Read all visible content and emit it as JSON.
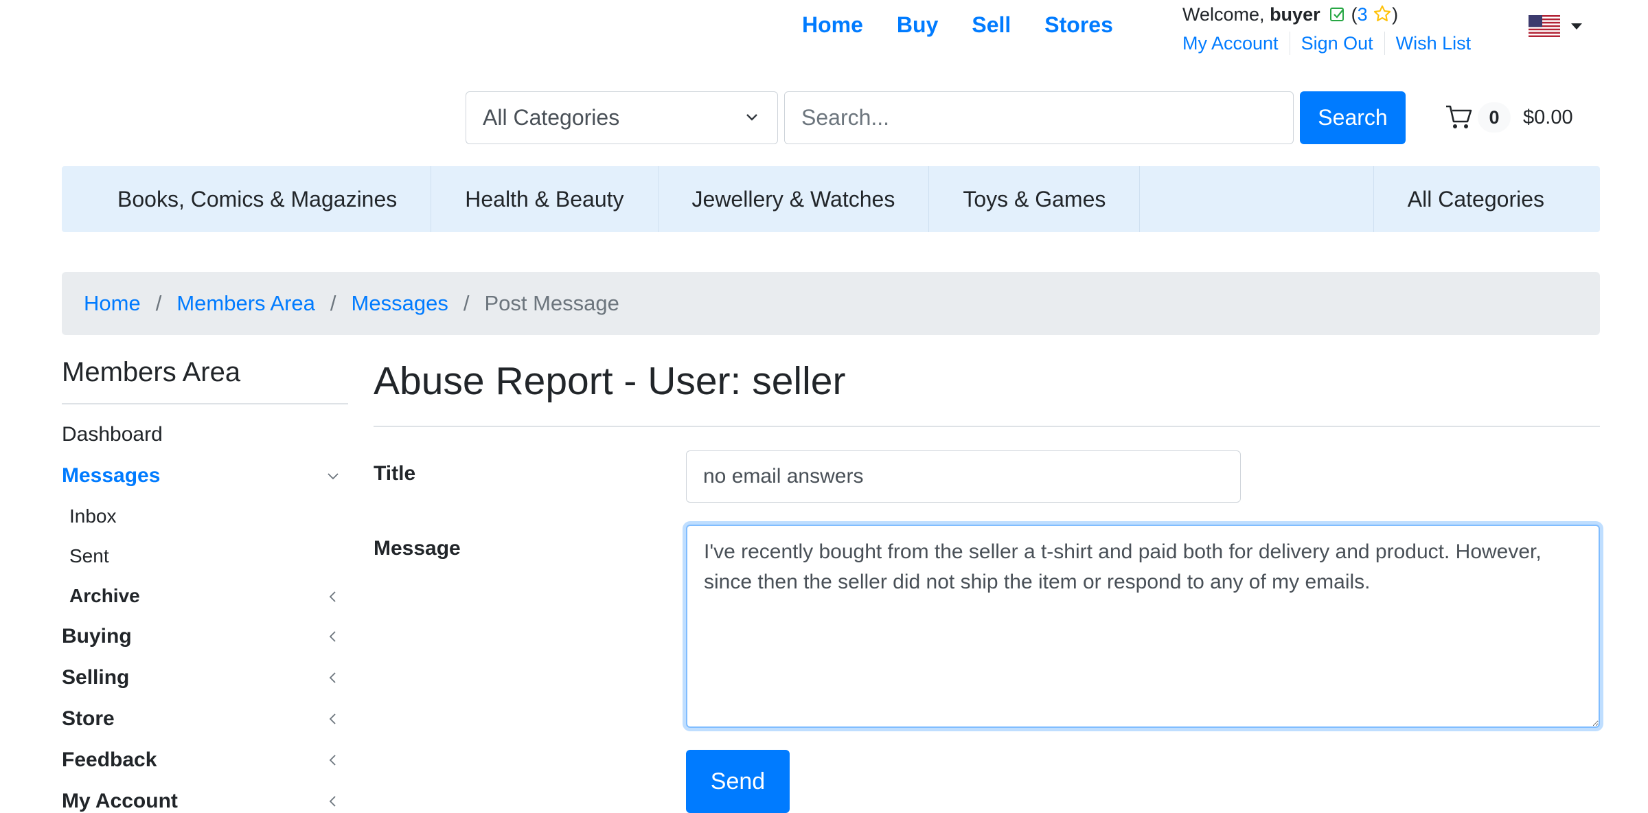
{
  "topnav": {
    "home": "Home",
    "buy": "Buy",
    "sell": "Sell",
    "stores": "Stores"
  },
  "user": {
    "welcome": "Welcome,",
    "username": "buyer",
    "paren_open": "(",
    "score": "3",
    "paren_close": ")",
    "verified_icon": "check-square-icon",
    "rating_icon": "star-icon"
  },
  "account_links": {
    "my_account": "My Account",
    "sign_out": "Sign Out",
    "wish_list": "Wish List"
  },
  "language": {
    "flag_icon": "us-flag-icon"
  },
  "search": {
    "category": "All Categories",
    "placeholder": "Search...",
    "button": "Search"
  },
  "cart": {
    "icon": "cart-icon",
    "count": "0",
    "total": "$0.00"
  },
  "categories": {
    "items": [
      "Books, Comics & Magazines",
      "Health & Beauty",
      "Jewellery & Watches",
      "Toys & Games"
    ],
    "all": "All Categories"
  },
  "breadcrumb": {
    "items": [
      "Home",
      "Members Area",
      "Messages"
    ],
    "sep": "/",
    "active": "Post Message"
  },
  "sidebar": {
    "title": "Members Area",
    "items": [
      {
        "label": "Dashboard"
      },
      {
        "label": "Messages"
      },
      {
        "label": "Inbox"
      },
      {
        "label": "Sent"
      },
      {
        "label": "Archive"
      },
      {
        "label": "Buying"
      },
      {
        "label": "Selling"
      },
      {
        "label": "Store"
      },
      {
        "label": "Feedback"
      },
      {
        "label": "My Account"
      }
    ]
  },
  "form": {
    "page_title": "Abuse Report - User: seller",
    "title_label": "Title",
    "title_value": "no email answers",
    "message_label": "Message",
    "message_value": "I've recently bought from the seller a t-shirt and paid both for delivery and product. However, since then the seller did not ship the item or respond to any of my emails.",
    "send": "Send"
  },
  "colors": {
    "primary": "#007bff",
    "category_bar": "#e3f0fc",
    "breadcrumb_bg": "#e9ecef",
    "star": "#ffc107",
    "verified": "#28a745"
  }
}
